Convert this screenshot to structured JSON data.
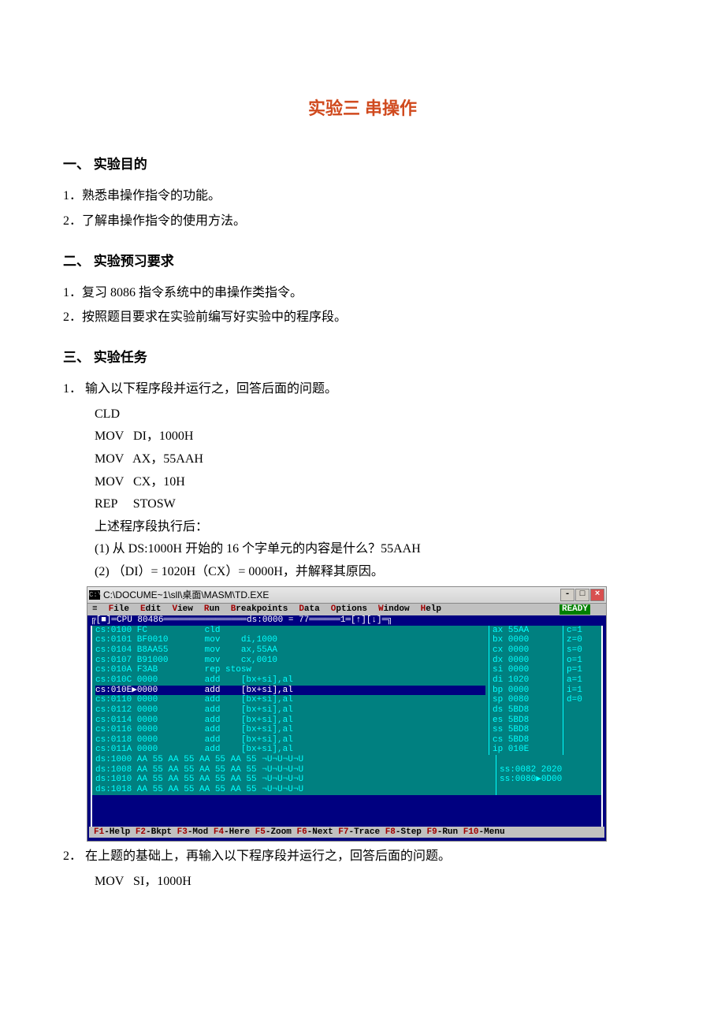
{
  "title": "实验三   串操作",
  "sec1": {
    "heading": "一、 实验目的",
    "p1": "1．熟悉串操作指令的功能。",
    "p2": "2．了解串操作指令的使用方法。"
  },
  "sec2": {
    "heading": "二、 实验预习要求",
    "p1": "1．复习 8086 指令系统中的串操作类指令。",
    "p2": "2．按照题目要求在实验前编写好实验中的程序段。"
  },
  "sec3": {
    "heading": "三、 实验任务"
  },
  "task1": {
    "intro": "1． 输入以下程序段并运行之，回答后面的问题。",
    "code": {
      "l1": "CLD",
      "l2": "MOV   DI，1000H",
      "l3": "MOV   AX，55AAH",
      "l4": "MOV   CX，10H",
      "l5": "REP     STOSW"
    },
    "after": "上述程序段执行后：",
    "q1": "(1) 从 DS:1000H 开始的 16 个字单元的内容是什么？55AAH",
    "q2": "(2) （DI）= 1020H（CX）= 0000H，并解释其原因。"
  },
  "task2": {
    "intro": "2． 在上题的基础上，再输入以下程序段并运行之，回答后面的问题。",
    "code": {
      "l1": "MOV   SI，1000H"
    }
  },
  "td": {
    "title": "C:\\DOCUME~1\\sll\\桌面\\MASM\\TD.EXE",
    "winbtn": {
      "min": "-",
      "max": "□",
      "close": "×"
    },
    "menu": {
      "file": "File",
      "edit": "Edit",
      "view": "View",
      "run": "Run",
      "bp": "Breakpoints",
      "data": "Data",
      "opt": "Options",
      "win": "Window",
      "help": "Help",
      "ready": "READY"
    },
    "header": "╔[■]═CPU 80486════════════════ds:0000 = 77══════1═[↑][↓]═╗",
    "asm": [
      {
        "a": "cs:0100 FC           cld                       ",
        "sel": false
      },
      {
        "a": "cs:0101 BF0010       mov    di,1000            ",
        "sel": false
      },
      {
        "a": "cs:0104 B8AA55       mov    ax,55AA            ",
        "sel": false
      },
      {
        "a": "cs:0107 B91000       mov    cx,0010            ",
        "sel": false
      },
      {
        "a": "cs:010A F3AB         rep stosw                 ",
        "sel": false
      },
      {
        "a": "cs:010C 0000         add    [bx+si],al         ",
        "sel": false
      },
      {
        "a": "cs:010E▶0000         add    [bx+si],al         ",
        "sel": true
      },
      {
        "a": "cs:0110 0000         add    [bx+si],al         ",
        "sel": false
      },
      {
        "a": "cs:0112 0000         add    [bx+si],al         ",
        "sel": false
      },
      {
        "a": "cs:0114 0000         add    [bx+si],al         ",
        "sel": false
      },
      {
        "a": "cs:0116 0000         add    [bx+si],al         ",
        "sel": false
      },
      {
        "a": "cs:0118 0000         add    [bx+si],al         ",
        "sel": false
      },
      {
        "a": "cs:011A 0000         add    [bx+si],al         ",
        "sel": false
      }
    ],
    "regs": [
      "ax 55AA",
      "bx 0000",
      "cx 0000",
      "dx 0000",
      "si 0000",
      "di 1020",
      "bp 0000",
      "sp 0080",
      "ds 5BD8",
      "es 5BD8",
      "ss 5BD8",
      "cs 5BD8",
      "ip 010E"
    ],
    "flags": [
      "c=1",
      "z=0",
      "s=0",
      "o=1",
      "p=1",
      "a=1",
      "i=1",
      "d=0"
    ],
    "dump": [
      "ds:1000 AA 55 AA 55 AA 55 AA 55 ¬U¬U¬U¬U",
      "ds:1008 AA 55 AA 55 AA 55 AA 55 ¬U¬U¬U¬U",
      "ds:1010 AA 55 AA 55 AA 55 AA 55 ¬U¬U¬U¬U",
      "ds:1018 AA 55 AA 55 AA 55 AA 55 ¬U¬U¬U¬U"
    ],
    "stack": [
      "",
      "ss:0082 2020",
      "ss:0080▶0D00",
      ""
    ],
    "fkeys_html": "F1-Help F2-Bkpt F3-Mod F4-Here F5-Zoom F6-Next F7-Trace F8-Step F9-Run F10-Menu"
  }
}
